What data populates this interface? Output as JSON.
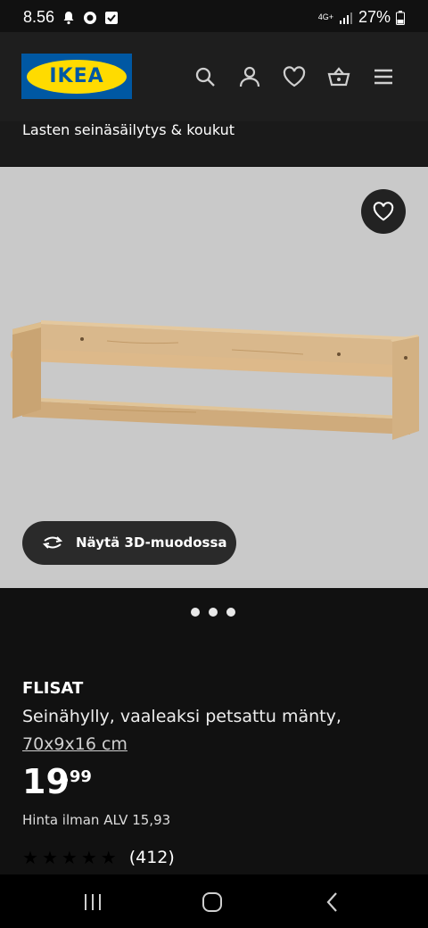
{
  "status_bar": {
    "time": "8.56",
    "network": "4G+",
    "battery": "27%"
  },
  "header": {
    "logo_text": "IKEA",
    "icons": [
      "search-icon",
      "account-icon",
      "heart-icon",
      "basket-icon",
      "menu-icon"
    ]
  },
  "breadcrumb": "Lasten seinäsäilytys & koukut",
  "gallery": {
    "view_3d_label": "Näytä 3D-muodossa",
    "dots_count": 3
  },
  "product": {
    "name": "FLISAT",
    "description": "Seinähylly, vaaleaksi petsattu mänty, ",
    "size": "70x9x16 cm",
    "price_whole": "19",
    "price_cents": ",99",
    "price_vat": "Hinta ilman ALV 15,93",
    "rating_stars": 5,
    "review_count": "(412)"
  },
  "colors": {
    "brand_blue": "#0058a3",
    "brand_yellow": "#ffdb00",
    "background": "#111111",
    "image_bg": "#c9c9c9"
  }
}
